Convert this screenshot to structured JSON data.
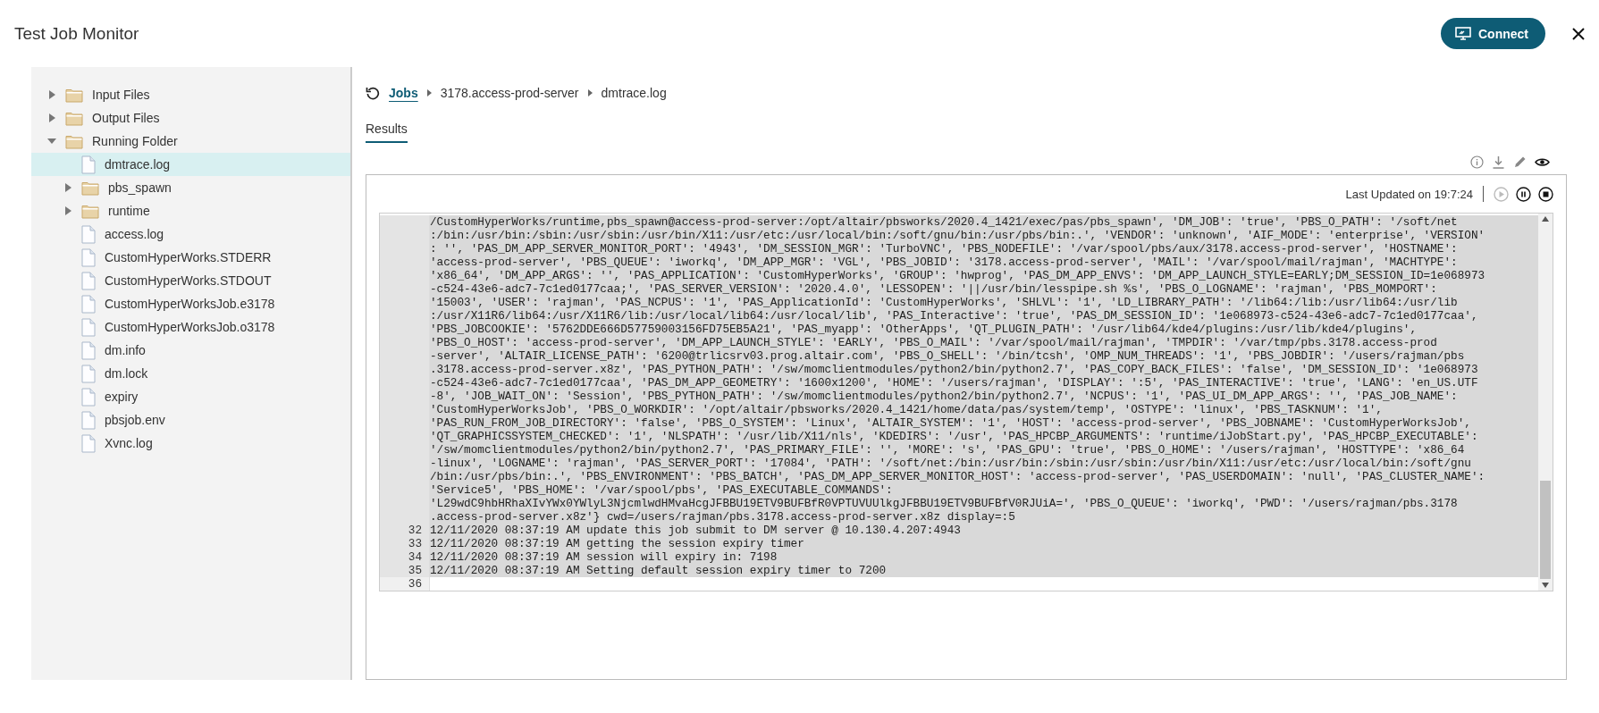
{
  "window": {
    "title": "Test Job Monitor",
    "connect_button": "Connect"
  },
  "file_tree": [
    {
      "label": "Input Files",
      "kind": "folder",
      "expanded": false,
      "selected": false
    },
    {
      "label": "Output Files",
      "kind": "folder",
      "expanded": false,
      "selected": false
    },
    {
      "label": "Running Folder",
      "kind": "folder",
      "expanded": true,
      "selected": false,
      "children": [
        {
          "label": "dmtrace.log",
          "kind": "file",
          "selected": true
        },
        {
          "label": "pbs_spawn",
          "kind": "folder",
          "expanded": false,
          "selected": false
        },
        {
          "label": "runtime",
          "kind": "folder",
          "expanded": false,
          "selected": false
        },
        {
          "label": "access.log",
          "kind": "file",
          "selected": false
        },
        {
          "label": "CustomHyperWorks.STDERR",
          "kind": "file",
          "selected": false
        },
        {
          "label": "CustomHyperWorks.STDOUT",
          "kind": "file",
          "selected": false
        },
        {
          "label": "CustomHyperWorksJob.e3178",
          "kind": "file",
          "selected": false
        },
        {
          "label": "CustomHyperWorksJob.o3178",
          "kind": "file",
          "selected": false
        },
        {
          "label": "dm.info",
          "kind": "file",
          "selected": false
        },
        {
          "label": "dm.lock",
          "kind": "file",
          "selected": false
        },
        {
          "label": "expiry",
          "kind": "file",
          "selected": false
        },
        {
          "label": "pbsjob.env",
          "kind": "file",
          "selected": false
        },
        {
          "label": "Xvnc.log",
          "kind": "file",
          "selected": false
        }
      ]
    }
  ],
  "breadcrumb": [
    "Jobs",
    "3178.access-prod-server",
    "dmtrace.log"
  ],
  "tabs": [
    {
      "label": "Results",
      "selected": true
    }
  ],
  "log": {
    "last_updated": "Last Updated on 19:7:24",
    "controls": [
      {
        "kind": "play",
        "disabled": true
      },
      {
        "kind": "pause",
        "disabled": false
      },
      {
        "kind": "stop",
        "disabled": false
      }
    ],
    "lines": [
      {
        "selected": true,
        "rows": [
          "/CustomHyperWorks/runtime,pbs_spawn@access-prod-server:/opt/altair/pbsworks/2020.4_1421/exec/pas/pbs_spawn', 'DM_JOB': 'true', 'PBS_O_PATH': '/soft/net",
          ":/bin:/usr/bin:/sbin:/usr/sbin:/usr/bin/X11:/usr/etc:/usr/local/bin:/soft/gnu/bin:/usr/pbs/bin:.', 'VENDOR': 'unknown', 'AIF_MODE': 'enterprise', 'VERSION'",
          ": '', 'PAS_DM_APP_SERVER_MONITOR_PORT': '4943', 'DM_SESSION_MGR': 'TurboVNC', 'PBS_NODEFILE': '/var/spool/pbs/aux/3178.access-prod-server', 'HOSTNAME':",
          "'access-prod-server', 'PBS_QUEUE': 'iworkq', 'DM_APP_MGR': 'VGL', 'PBS_JOBID': '3178.access-prod-server', 'MAIL': '/var/spool/mail/rajman', 'MACHTYPE':",
          "'x86_64', 'DM_APP_ARGS': '', 'PAS_APPLICATION': 'CustomHyperWorks', 'GROUP': 'hwprog', 'PAS_DM_APP_ENVS': 'DM_APP_LAUNCH_STYLE=EARLY;DM_SESSION_ID=1e068973",
          "-c524-43e6-adc7-7c1ed0177caa;', 'PAS_SERVER_VERSION': '2020.4.0', 'LESSOPEN': '||/usr/bin/lesspipe.sh %s', 'PBS_O_LOGNAME': 'rajman', 'PBS_MOMPORT':",
          "'15003', 'USER': 'rajman', 'PAS_NCPUS': '1', 'PAS_ApplicationId': 'CustomHyperWorks', 'SHLVL': '1', 'LD_LIBRARY_PATH': '/lib64:/lib:/usr/lib64:/usr/lib",
          ":/usr/X11R6/lib64:/usr/X11R6/lib:/usr/local/lib64:/usr/local/lib', 'PAS_Interactive': 'true', 'PAS_DM_SESSION_ID': '1e068973-c524-43e6-adc7-7c1ed0177caa',",
          "'PBS_JOBCOOKIE': '5762DDE666D57759003156FD75EB5A21', 'PAS_myapp': 'OtherApps', 'QT_PLUGIN_PATH': '/usr/lib64/kde4/plugins:/usr/lib/kde4/plugins',",
          "'PBS_O_HOST': 'access-prod-server', 'DM_APP_LAUNCH_STYLE': 'EARLY', 'PBS_O_MAIL': '/var/spool/mail/rajman', 'TMPDIR': '/var/tmp/pbs.3178.access-prod",
          "-server', 'ALTAIR_LICENSE_PATH': '6200@trlicsrv03.prog.altair.com', 'PBS_O_SHELL': '/bin/tcsh', 'OMP_NUM_THREADS': '1', 'PBS_JOBDIR': '/users/rajman/pbs",
          ".3178.access-prod-server.x8z', 'PAS_PYTHON_PATH': '/sw/momclientmodules/python2/bin/python2.7', 'PAS_COPY_BACK_FILES': 'false', 'DM_SESSION_ID': '1e068973",
          "-c524-43e6-adc7-7c1ed0177caa', 'PAS_DM_APP_GEOMETRY': '1600x1200', 'HOME': '/users/rajman', 'DISPLAY': ':5', 'PAS_INTERACTIVE': 'true', 'LANG': 'en_US.UTF",
          "-8', 'JOB_WAIT_ON': 'Session', 'PBS_PYTHON_PATH': '/sw/momclientmodules/python2/bin/python2.7', 'NCPUS': '1', 'PAS_UI_DM_APP_ARGS': '', 'PAS_JOB_NAME':",
          "'CustomHyperWorksJob', 'PBS_O_WORKDIR': '/opt/altair/pbsworks/2020.4_1421/home/data/pas/system/temp', 'OSTYPE': 'linux', 'PBS_TASKNUM': '1',",
          "'PAS_RUN_FROM_JOB_DIRECTORY': 'false', 'PBS_O_SYSTEM': 'Linux', 'ALTAIR_SYSTEM': '1', 'HOST': 'access-prod-server', 'PBS_JOBNAME': 'CustomHyperWorksJob',",
          "'QT_GRAPHICSSYSTEM_CHECKED': '1', 'NLSPATH': '/usr/lib/X11/nls', 'KDEDIRS': '/usr', 'PAS_HPCBP_ARGUMENTS': 'runtime/iJobStart.py', 'PAS_HPCBP_EXECUTABLE':",
          "'/sw/momclientmodules/python2/bin/python2.7', 'PAS_PRIMARY_FILE': '', 'MORE': 's', 'PAS_GPU': 'true', 'PBS_O_HOME': '/users/rajman', 'HOSTTYPE': 'x86_64",
          "-linux', 'LOGNAME': 'rajman', 'PAS_SERVER_PORT': '17084', 'PATH': '/soft/net:/bin:/usr/bin:/sbin:/usr/sbin:/usr/bin/X11:/usr/etc:/usr/local/bin:/soft/gnu",
          "/bin:/usr/pbs/bin:.', 'PBS_ENVIRONMENT': 'PBS_BATCH', 'PAS_DM_APP_SERVER_MONITOR_HOST': 'access-prod-server', 'PAS_USERDOMAIN': 'null', 'PAS_CLUSTER_NAME':",
          "'Service5', 'PBS_HOME': '/var/spool/pbs', 'PAS_EXECUTABLE_COMMANDS':",
          "'L29wdC9hbHRhaXIvYWx0YWlyL3NjcmlwdHMvaHcgJFBBU19ETV9BUFBfR0VPTUVUUlkgJFBBU19ETV9BUFBfV0RJUiA=', 'PBS_O_QUEUE': 'iworkq', 'PWD': '/users/rajman/pbs.3178",
          ".access-prod-server.x8z'} cwd=/users/rajman/pbs.3178.access-prod-server.x8z display=:5"
        ]
      },
      {
        "number": "32",
        "text": "12/11/2020 08:37:19 AM update this job submit to DM server @ 10.130.4.207:4943",
        "selected": true
      },
      {
        "number": "33",
        "text": "12/11/2020 08:37:19 AM getting the session expiry timer",
        "selected": true
      },
      {
        "number": "34",
        "text": "12/11/2020 08:37:19 AM session will expiry in: 7198",
        "selected": true
      },
      {
        "number": "35",
        "text": "12/11/2020 08:37:19 AM Setting default session expiry timer to 7200",
        "selected": true
      },
      {
        "number": "36",
        "selected": false
      }
    ]
  }
}
